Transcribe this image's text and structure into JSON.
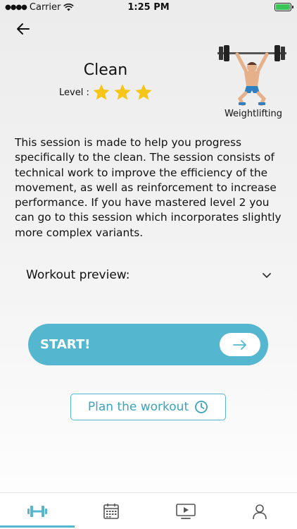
{
  "status_bar": {
    "carrier": "Carrier",
    "time": "1:25 PM"
  },
  "workout": {
    "title": "Clean",
    "level_label": "Level :",
    "level": 3,
    "level_max": 3,
    "category": "Weightlifting",
    "description": "This session is made to help you progress specifically to the clean. The session consists of technical work to improve the efficiency of the movement, as well as reinforcement to increase performance. If you have mastered level 2 you can go to this session which incorporates slightly more complex variants."
  },
  "preview": {
    "label": "Workout preview:"
  },
  "actions": {
    "start_label": "START!",
    "plan_label": "Plan the workout"
  },
  "colors": {
    "accent": "#55b7cf",
    "star": "#f5c518"
  },
  "tabs": [
    {
      "icon": "dumbbell-icon",
      "active": true
    },
    {
      "icon": "calendar-icon",
      "active": false
    },
    {
      "icon": "video-icon",
      "active": false
    },
    {
      "icon": "profile-icon",
      "active": false
    }
  ]
}
